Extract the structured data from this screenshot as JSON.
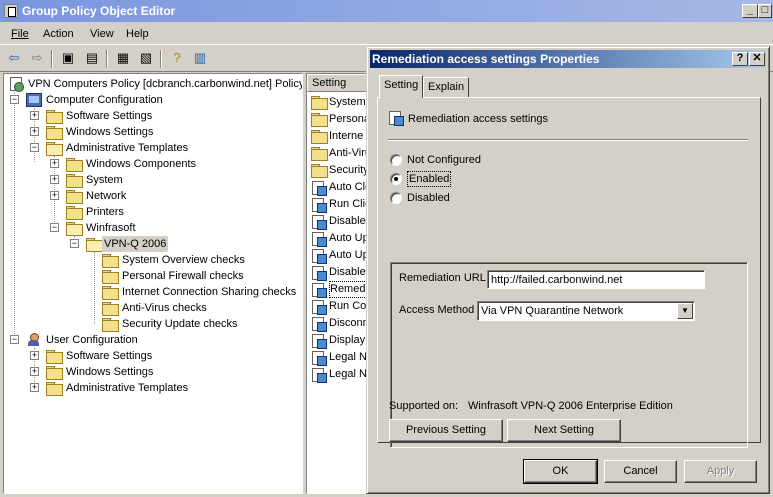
{
  "window": {
    "title": "Group Policy Object Editor",
    "min_glyph": "_",
    "max_glyph": "□"
  },
  "menu": [
    "File",
    "Action",
    "View",
    "Help"
  ],
  "toolbar": {
    "icons": [
      "back-arrow-icon",
      "forward-arrow-icon",
      "up-folder-icon",
      "show-tree-icon",
      "properties-icon",
      "export-list-icon",
      "help-icon",
      "help-topics-icon"
    ]
  },
  "tree": {
    "root": "VPN Computers Policy [dcbranch.carbonwind.net] Policy",
    "computer_config": "Computer Configuration",
    "cc_software": "Software Settings",
    "cc_windows": "Windows Settings",
    "cc_admin": "Administrative Templates",
    "windows_components": "Windows Components",
    "system": "System",
    "network": "Network",
    "printers": "Printers",
    "winfrasoft": "Winfrasoft",
    "vpnq": "VPN-Q 2006",
    "checks": [
      "System Overview checks",
      "Personal Firewall checks",
      "Internet Connection Sharing checks",
      "Anti-Virus checks",
      "Security Update checks"
    ],
    "user_config": "User Configuration",
    "uc_software": "Software Settings",
    "uc_windows": "Windows Settings",
    "uc_admin": "Administrative Templates",
    "expander_plus": "+",
    "expander_minus": "−"
  },
  "list": {
    "column": "Setting",
    "items": [
      "System",
      "Persona",
      "Interne",
      "Anti-Viru",
      "Security",
      "Auto Clo",
      "Run Clie",
      "Disable",
      "Auto Up",
      "Auto Up",
      "Disable",
      "Remedia",
      "Run Con",
      "Disconn",
      "Display",
      "Legal No",
      "Legal No"
    ],
    "selected_index": 11
  },
  "dialog": {
    "title": "Remediation access settings Properties",
    "help_glyph": "?",
    "close_glyph": "✕",
    "tabs": [
      "Setting",
      "Explain"
    ],
    "setting_name": "Remediation access settings",
    "radios": [
      "Not Configured",
      "Enabled",
      "Disabled"
    ],
    "selected_radio": 1,
    "url_label": "Remediation URL",
    "url_value": "http://failed.carbonwind.net",
    "method_label": "Access Method",
    "method_value": "Via VPN Quarantine Network",
    "arrow_glyph": "▼",
    "supported_label": "Supported on:",
    "supported_value": "Winfrasoft VPN-Q 2006 Enterprise Edition",
    "prev_button": "Previous Setting",
    "next_button": "Next Setting",
    "ok_button": "OK",
    "cancel_button": "Cancel",
    "apply_button": "Apply"
  }
}
